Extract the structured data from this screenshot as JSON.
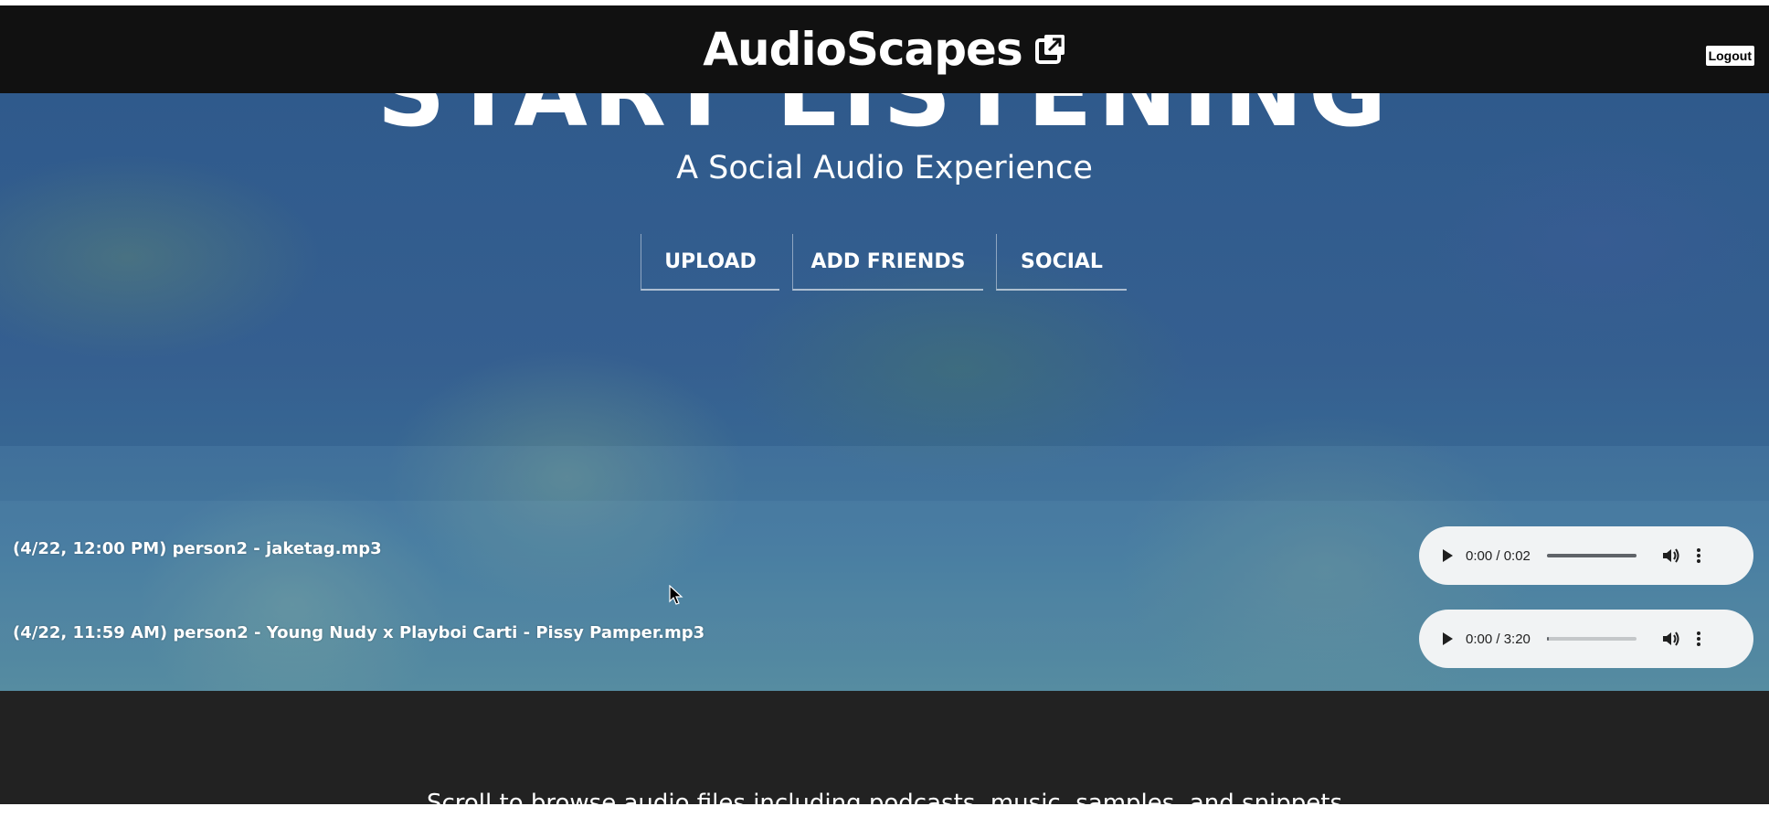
{
  "header": {
    "brand": "AudioScapes",
    "brand_icon": "external-link-icon",
    "logout_label": "Logout"
  },
  "hero": {
    "title": "START LISTENING",
    "subtitle": "A Social Audio Experience",
    "nav": [
      {
        "label": "UPLOAD"
      },
      {
        "label": "ADD FRIENDS"
      },
      {
        "label": "SOCIAL"
      }
    ]
  },
  "tracks": [
    {
      "title": "(4/22, 12:00 PM) person2 - jaketag.mp3",
      "time": "0:00 / 0:02",
      "progress": 1.0
    },
    {
      "title": "(4/22, 11:59 AM) person2 - Young Nudy x Playboi Carti - Pissy Pamper.mp3",
      "time": "0:00 / 3:20",
      "progress": 0.02
    }
  ],
  "footer": {
    "text": "Scroll to browse audio files including podcasts, music, samples, and snippets"
  },
  "colors": {
    "header_bg": "#111111",
    "hero_bg": "#355f90",
    "footer_bg": "#222222",
    "player_bg": "#f1f3f4"
  }
}
